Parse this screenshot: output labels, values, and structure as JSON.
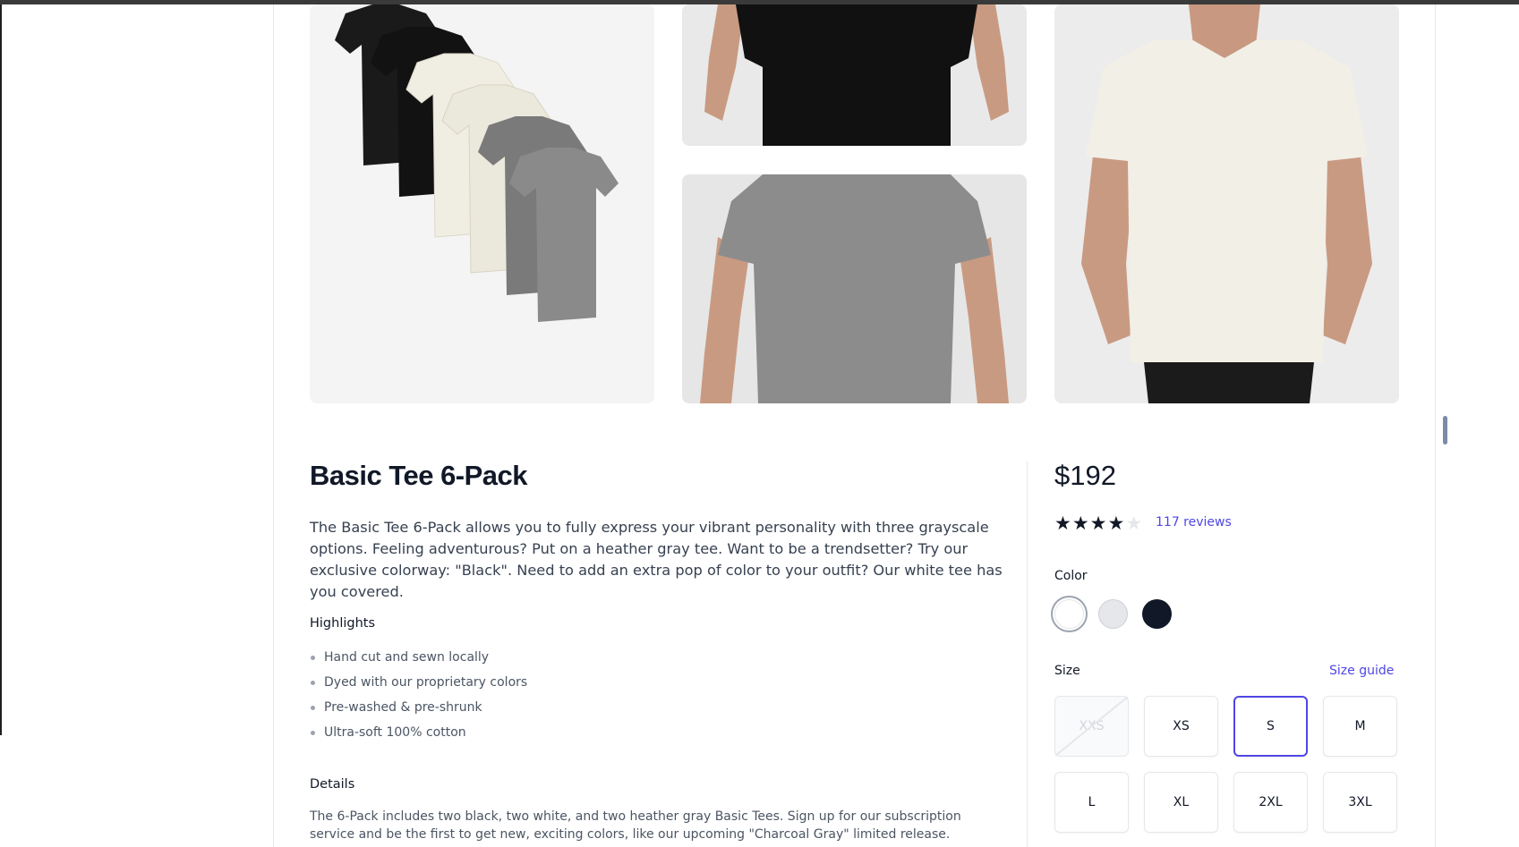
{
  "product": {
    "title": "Basic Tee 6-Pack",
    "description": "The Basic Tee 6-Pack allows you to fully express your vibrant personality with three grayscale options. Feeling adventurous? Put on a heather gray tee. Want to be a trendsetter? Try our exclusive colorway: \"Black\". Need to add an extra pop of color to your outfit? Our white tee has you covered.",
    "price": "$192",
    "rating": 4,
    "rating_max": 5,
    "reviews_text": "117 reviews"
  },
  "highlights": {
    "heading": "Highlights",
    "items": [
      "Hand cut and sewn locally",
      "Dyed with our proprietary colors",
      "Pre-washed & pre-shrunk",
      "Ultra-soft 100% cotton"
    ]
  },
  "details": {
    "heading": "Details",
    "text": "The 6-Pack includes two black, two white, and two heather gray Basic Tees. Sign up for our subscription service and be the first to get new, exciting colors, like our upcoming \"Charcoal Gray\" limited release."
  },
  "color": {
    "label": "Color",
    "options": [
      {
        "hex": "#ffffff",
        "selected": true
      },
      {
        "hex": "#e5e7eb",
        "selected": false
      },
      {
        "hex": "#111827",
        "selected": false
      }
    ]
  },
  "size": {
    "label": "Size",
    "guide_label": "Size guide",
    "options": [
      {
        "label": "XXS",
        "state": "disabled"
      },
      {
        "label": "XS",
        "state": "available"
      },
      {
        "label": "S",
        "state": "selected"
      },
      {
        "label": "M",
        "state": "available"
      },
      {
        "label": "L",
        "state": "available"
      },
      {
        "label": "XL",
        "state": "available"
      },
      {
        "label": "2XL",
        "state": "available"
      },
      {
        "label": "3XL",
        "state": "available"
      }
    ]
  },
  "gallery": {
    "images": [
      {
        "icon": "stacked-tees-image"
      },
      {
        "icon": "black-tee-model-image"
      },
      {
        "icon": "gray-tee-model-image"
      },
      {
        "icon": "white-tee-model-image"
      }
    ]
  },
  "colors": {
    "accent": "#4f46e5",
    "star": "#111827",
    "star_empty": "#e5e7eb"
  }
}
